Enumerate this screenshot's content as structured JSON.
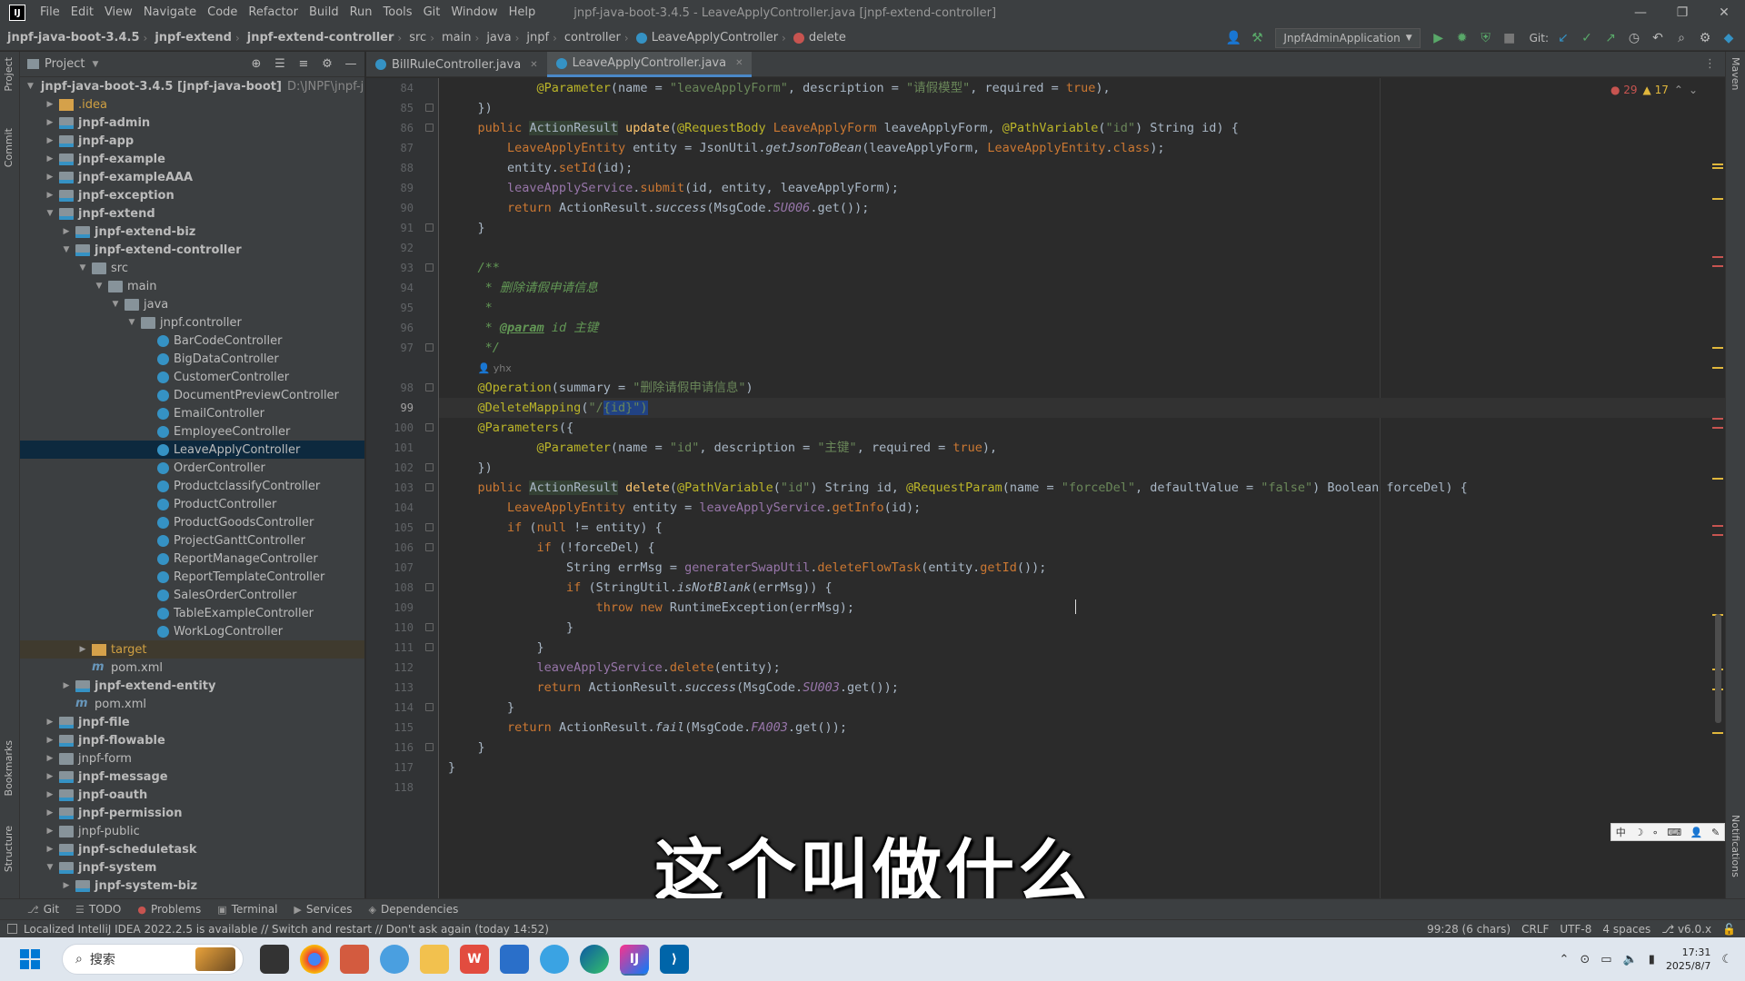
{
  "window": {
    "app_logo": "IJ",
    "title": "jnpf-java-boot-3.4.5 - LeaveApplyController.java [jnpf-extend-controller]",
    "menu": [
      "File",
      "Edit",
      "View",
      "Navigate",
      "Code",
      "Refactor",
      "Build",
      "Run",
      "Tools",
      "Git",
      "Window",
      "Help"
    ]
  },
  "breadcrumb": [
    "jnpf-java-boot-3.4.5",
    "jnpf-extend",
    "jnpf-extend-controller",
    "src",
    "main",
    "java",
    "jnpf",
    "controller",
    "LeaveApplyController",
    "delete"
  ],
  "toolbar": {
    "run_config": "JnpfAdminApplication",
    "git_label": "Git:"
  },
  "project_panel": {
    "title": "Project",
    "tree": [
      {
        "indent": 0,
        "arrow": "v",
        "icon": "module",
        "label": "jnpf-java-boot-3.4.5 [jnpf-java-boot]",
        "path": "D:\\JNPF\\jnpf-java-b",
        "style": "bold"
      },
      {
        "indent": 1,
        "arrow": ">",
        "icon": "orange",
        "label": ".idea",
        "style": "idea"
      },
      {
        "indent": 1,
        "arrow": ">",
        "icon": "module",
        "label": "jnpf-admin",
        "style": "bold"
      },
      {
        "indent": 1,
        "arrow": ">",
        "icon": "module",
        "label": "jnpf-app",
        "style": "bold"
      },
      {
        "indent": 1,
        "arrow": ">",
        "icon": "module",
        "label": "jnpf-example",
        "style": "bold"
      },
      {
        "indent": 1,
        "arrow": ">",
        "icon": "module",
        "label": "jnpf-exampleAAA",
        "style": "bold"
      },
      {
        "indent": 1,
        "arrow": ">",
        "icon": "module",
        "label": "jnpf-exception",
        "style": "bold"
      },
      {
        "indent": 1,
        "arrow": "v",
        "icon": "module",
        "label": "jnpf-extend",
        "style": "bold"
      },
      {
        "indent": 2,
        "arrow": ">",
        "icon": "module",
        "label": "jnpf-extend-biz",
        "style": "bold"
      },
      {
        "indent": 2,
        "arrow": "v",
        "icon": "module",
        "label": "jnpf-extend-controller",
        "style": "bold"
      },
      {
        "indent": 3,
        "arrow": "v",
        "icon": "folder",
        "label": "src",
        "style": ""
      },
      {
        "indent": 4,
        "arrow": "v",
        "icon": "folder",
        "label": "main",
        "style": ""
      },
      {
        "indent": 5,
        "arrow": "v",
        "icon": "srcfolder",
        "label": "java",
        "style": ""
      },
      {
        "indent": 6,
        "arrow": "v",
        "icon": "pkg",
        "label": "jnpf.controller",
        "style": ""
      },
      {
        "indent": 7,
        "arrow": "",
        "icon": "java",
        "label": "BarCodeController",
        "style": ""
      },
      {
        "indent": 7,
        "arrow": "",
        "icon": "java",
        "label": "BigDataController",
        "style": ""
      },
      {
        "indent": 7,
        "arrow": "",
        "icon": "java",
        "label": "CustomerController",
        "style": ""
      },
      {
        "indent": 7,
        "arrow": "",
        "icon": "java",
        "label": "DocumentPreviewController",
        "style": ""
      },
      {
        "indent": 7,
        "arrow": "",
        "icon": "java",
        "label": "EmailController",
        "style": ""
      },
      {
        "indent": 7,
        "arrow": "",
        "icon": "java",
        "label": "EmployeeController",
        "style": ""
      },
      {
        "indent": 7,
        "arrow": "",
        "icon": "java",
        "label": "LeaveApplyController",
        "style": "",
        "selected": true
      },
      {
        "indent": 7,
        "arrow": "",
        "icon": "java",
        "label": "OrderController",
        "style": ""
      },
      {
        "indent": 7,
        "arrow": "",
        "icon": "java",
        "label": "ProductclassifyController",
        "style": ""
      },
      {
        "indent": 7,
        "arrow": "",
        "icon": "java",
        "label": "ProductController",
        "style": ""
      },
      {
        "indent": 7,
        "arrow": "",
        "icon": "java",
        "label": "ProductGoodsController",
        "style": ""
      },
      {
        "indent": 7,
        "arrow": "",
        "icon": "java",
        "label": "ProjectGanttController",
        "style": ""
      },
      {
        "indent": 7,
        "arrow": "",
        "icon": "java",
        "label": "ReportManageController",
        "style": ""
      },
      {
        "indent": 7,
        "arrow": "",
        "icon": "java",
        "label": "ReportTemplateController",
        "style": ""
      },
      {
        "indent": 7,
        "arrow": "",
        "icon": "java",
        "label": "SalesOrderController",
        "style": ""
      },
      {
        "indent": 7,
        "arrow": "",
        "icon": "java",
        "label": "TableExampleController",
        "style": ""
      },
      {
        "indent": 7,
        "arrow": "",
        "icon": "java",
        "label": "WorkLogController",
        "style": ""
      },
      {
        "indent": 3,
        "arrow": ">",
        "icon": "orange",
        "label": "target",
        "style": "muted",
        "excluded": true
      },
      {
        "indent": 3,
        "arrow": "",
        "icon": "maven",
        "label": "pom.xml",
        "style": ""
      },
      {
        "indent": 2,
        "arrow": ">",
        "icon": "module",
        "label": "jnpf-extend-entity",
        "style": "bold"
      },
      {
        "indent": 2,
        "arrow": "",
        "icon": "maven",
        "label": "pom.xml",
        "style": ""
      },
      {
        "indent": 1,
        "arrow": ">",
        "icon": "module",
        "label": "jnpf-file",
        "style": "bold"
      },
      {
        "indent": 1,
        "arrow": ">",
        "icon": "module",
        "label": "jnpf-flowable",
        "style": "bold"
      },
      {
        "indent": 1,
        "arrow": ">",
        "icon": "folder",
        "label": "jnpf-form",
        "style": ""
      },
      {
        "indent": 1,
        "arrow": ">",
        "icon": "module",
        "label": "jnpf-message",
        "style": "bold"
      },
      {
        "indent": 1,
        "arrow": ">",
        "icon": "module",
        "label": "jnpf-oauth",
        "style": "bold"
      },
      {
        "indent": 1,
        "arrow": ">",
        "icon": "module",
        "label": "jnpf-permission",
        "style": "bold"
      },
      {
        "indent": 1,
        "arrow": ">",
        "icon": "folder",
        "label": "jnpf-public",
        "style": ""
      },
      {
        "indent": 1,
        "arrow": ">",
        "icon": "module",
        "label": "jnpf-scheduletask",
        "style": "bold"
      },
      {
        "indent": 1,
        "arrow": "v",
        "icon": "module",
        "label": "jnpf-system",
        "style": "bold"
      },
      {
        "indent": 2,
        "arrow": ">",
        "icon": "module",
        "label": "jnpf-system-biz",
        "style": "bold"
      }
    ]
  },
  "tool_strip": {
    "left": [
      "Project",
      "Commit",
      "Bookmarks",
      "Structure"
    ],
    "right": [
      "Maven",
      "Notifications"
    ]
  },
  "editor": {
    "tabs": [
      {
        "label": "BillRuleController.java",
        "active": false
      },
      {
        "label": "LeaveApplyController.java",
        "active": true
      }
    ],
    "errors": "29",
    "warnings": "17",
    "current_line": 99,
    "lines": [
      {
        "no": 84,
        "html": "            <span class=\"ann\">@Parameter</span>(name = <span class=\"str\">\"leaveApplyForm\"</span>, description = <span class=\"str\">\"请假模型\"</span>, required = <span class=\"kw\">true</span>),"
      },
      {
        "no": 85,
        "html": "    })"
      },
      {
        "no": 86,
        "html": "    <span class=\"kw\">public</span> <span class=\"hl-type\">ActionResult</span> <span class=\"method\">update</span>(<span class=\"ann\">@RequestBody</span> <span class=\"usertype\">LeaveApplyForm</span> leaveApplyForm, <span class=\"ann\">@PathVariable</span>(<span class=\"str\">\"id\"</span>) String id) {"
      },
      {
        "no": 87,
        "html": "        <span class=\"usertype\">LeaveApplyEntity</span> entity = JsonUtil.<span class=\"italic\">getJsonToBean</span>(leaveApplyForm, <span class=\"usertype\">LeaveApplyEntity</span>.<span class=\"kw\">class</span>);"
      },
      {
        "no": 88,
        "html": "        entity.<span class=\"mcall\">setId</span>(id);"
      },
      {
        "no": 89,
        "html": "        <span class=\"field\">leaveApplyService</span>.<span class=\"mcall\">submit</span>(id, entity, leaveApplyForm);"
      },
      {
        "no": 90,
        "html": "        <span class=\"kw\">return</span> ActionResult.<span class=\"italic\">success</span>(MsgCode.<span class=\"sfield\">SU006</span>.get());"
      },
      {
        "no": 91,
        "html": "    }"
      },
      {
        "no": 92,
        "html": ""
      },
      {
        "no": 93,
        "html": "    <span class=\"cmt\">/**</span>"
      },
      {
        "no": 94,
        "html": "     <span class=\"cmt\">* 删除请假申请信息</span>"
      },
      {
        "no": 95,
        "html": "     <span class=\"cmt\">*</span>"
      },
      {
        "no": 96,
        "html": "     <span class=\"cmt\">* </span><span class=\"doctag\">@param</span><span class=\"cmt\"> id 主键</span>"
      },
      {
        "no": 97,
        "html": "     <span class=\"cmt\">*/</span>"
      },
      {
        "no": null,
        "html": "    <span class=\"author\">👤 yhx</span>"
      },
      {
        "no": 98,
        "html": "    <span class=\"ann\">@Operation</span>(summary = <span class=\"str\">\"删除请假申请信息\"</span>)"
      },
      {
        "no": 99,
        "html": "    <span class=\"ann\">@DeleteMapping</span>(<span class=\"str\">\"/</span><span class=\"sel\"><span class=\"str\">{id}\")</span></span>"
      },
      {
        "no": 100,
        "html": "    <span class=\"ann\">@Parameters</span>({"
      },
      {
        "no": 101,
        "html": "            <span class=\"ann\">@Parameter</span>(name = <span class=\"str\">\"id\"</span>, description = <span class=\"str\">\"主键\"</span>, required = <span class=\"kw\">true</span>),"
      },
      {
        "no": 102,
        "html": "    })"
      },
      {
        "no": 103,
        "html": "    <span class=\"kw\">public</span> <span class=\"hl-type\">ActionResult</span> <span class=\"method\">delete</span>(<span class=\"ann\">@PathVariable</span>(<span class=\"str\">\"id\"</span>) String id, <span class=\"ann\">@RequestParam</span>(name = <span class=\"str\">\"forceDel\"</span>, defaultValue = <span class=\"str\">\"false\"</span>) Boolean forceDel) {"
      },
      {
        "no": 104,
        "html": "        <span class=\"usertype\">LeaveApplyEntity</span> entity = <span class=\"field\">leaveApplyService</span>.<span class=\"mcall\">getInfo</span>(id);"
      },
      {
        "no": 105,
        "html": "        <span class=\"kw\">if</span> (<span class=\"kw\">null</span> != entity) {"
      },
      {
        "no": 106,
        "html": "            <span class=\"kw\">if</span> (!forceDel) {"
      },
      {
        "no": 107,
        "html": "                String errMsg = <span class=\"field\">generaterSwapUtil</span>.<span class=\"mcall\">deleteFlowTask</span>(entity.<span class=\"mcall\">getId</span>());"
      },
      {
        "no": 108,
        "html": "                <span class=\"kw\">if</span> (StringUtil.<span class=\"italic\">isNotBlank</span>(errMsg)) {"
      },
      {
        "no": 109,
        "html": "                    <span class=\"kw\">throw new</span> RuntimeException(errMsg);"
      },
      {
        "no": 110,
        "html": "                }"
      },
      {
        "no": 111,
        "html": "            }"
      },
      {
        "no": 112,
        "html": "            <span class=\"field\">leaveApplyService</span>.<span class=\"mcall\">delete</span>(entity);"
      },
      {
        "no": 113,
        "html": "            <span class=\"kw\">return</span> ActionResult.<span class=\"italic\">success</span>(MsgCode.<span class=\"sfield\">SU003</span>.get());"
      },
      {
        "no": 114,
        "html": "        }"
      },
      {
        "no": 115,
        "html": "        <span class=\"kw\">return</span> ActionResult.<span class=\"italic\">fail</span>(MsgCode.<span class=\"sfield\">FA003</span>.get());"
      },
      {
        "no": 116,
        "html": "    }"
      },
      {
        "no": 117,
        "html": "}"
      },
      {
        "no": 118,
        "html": ""
      }
    ]
  },
  "subtitle": "这个叫做什么",
  "ime_bar": [
    "中",
    "☽",
    "∘",
    "⌨",
    "👤",
    "✎"
  ],
  "tool_windows": [
    {
      "icon": "git-icon",
      "glyph": "⎇",
      "label": "Git"
    },
    {
      "icon": "todo-icon",
      "glyph": "☰",
      "label": "TODO"
    },
    {
      "icon": "problems-icon",
      "glyph": "●",
      "label": "Problems"
    },
    {
      "icon": "terminal-icon",
      "glyph": "▣",
      "label": "Terminal"
    },
    {
      "icon": "services-icon",
      "glyph": "▶",
      "label": "Services"
    },
    {
      "icon": "dependencies-icon",
      "glyph": "◈",
      "label": "Dependencies"
    }
  ],
  "status": {
    "message": "Localized IntelliJ IDEA 2022.2.5 is available // Switch and restart // Don't ask again (today 14:52)",
    "position": "99:28 (6 chars)",
    "line_sep": "CRLF",
    "encoding": "UTF-8",
    "indent": "4 spaces",
    "vcs": "v6.0.x"
  },
  "taskbar": {
    "search_placeholder": "搜索",
    "time": "17:31",
    "date": "2025/8/7"
  }
}
